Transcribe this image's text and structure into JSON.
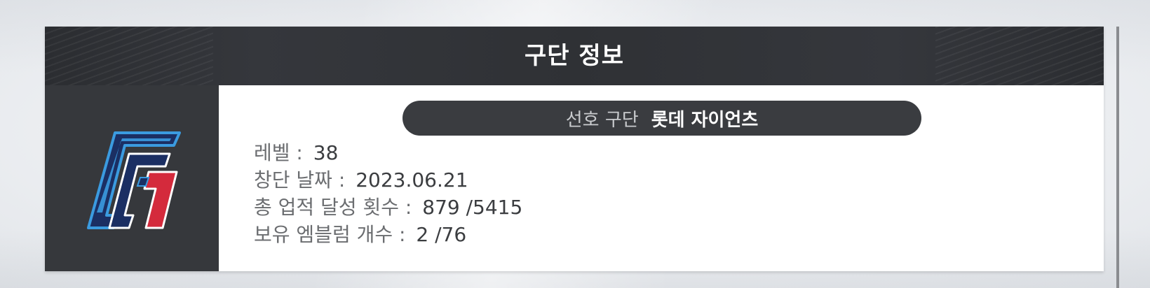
{
  "header": {
    "title": "구단 정보"
  },
  "emblem": {
    "icon": "team-g-logo-icon",
    "colors": {
      "navy": "#1b2f63",
      "blue": "#3b9be0",
      "red": "#d42a3c"
    }
  },
  "favorite_team": {
    "label": "선호 구단",
    "value": "롯데 자이언츠"
  },
  "stats": {
    "level_label": "레벨 :",
    "level_value": "38",
    "founded_label": "창단 날짜 :",
    "founded_value": "2023.06.21",
    "achievements_label": "총 업적 달성 횟수 :",
    "achievements_value": "879 /5415",
    "emblems_label": "보유 엠블럼 개수 :",
    "emblems_value": "2 /76"
  },
  "colors": {
    "header_bg": "#2f3135",
    "emblem_bg": "#36383c",
    "pill_bg": "#3a3c40",
    "label_text": "#6b6d70",
    "value_text": "#3b3d40"
  }
}
